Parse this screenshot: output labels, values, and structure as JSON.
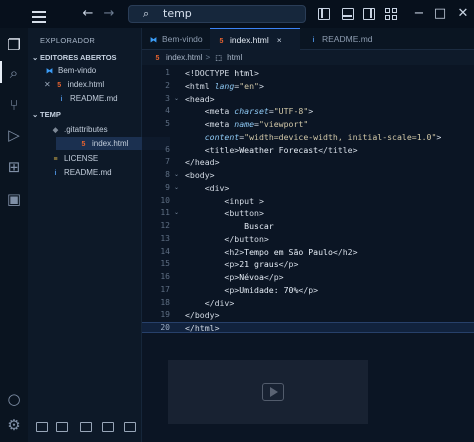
{
  "window": {
    "search_text": "temp",
    "search_icon": "⌕",
    "back_glyph": "←",
    "forward_glyph": "→",
    "minimize_glyph": "−",
    "maximize_glyph": "□",
    "close_glyph": "✕"
  },
  "sidebar": {
    "title": "EXPLORADOR",
    "open_editors_label": "EDITORES ABERTOS",
    "open_editors": [
      {
        "name": "Bem-vindo",
        "icon": "vscode-icon",
        "badge": "⚒"
      },
      {
        "name": "index.html",
        "icon": "html-icon",
        "badge": "5"
      },
      {
        "name": "README.md",
        "icon": "markdown-icon",
        "badge": "i"
      }
    ],
    "folder_label": "TEMP",
    "files": [
      {
        "name": ".gitattributes",
        "icon": "git-icon",
        "badge": "◆"
      },
      {
        "name": "index.html",
        "icon": "html-icon",
        "badge": "5"
      },
      {
        "name": "LICENSE",
        "icon": "license-icon",
        "badge": "≡"
      },
      {
        "name": "README.md",
        "icon": "markdown-icon",
        "badge": "i"
      }
    ]
  },
  "tabs": [
    {
      "label": "Bem-vindo",
      "badge": "⚒"
    },
    {
      "label": "index.html",
      "badge": "5",
      "close": "×"
    },
    {
      "label": "README.md",
      "badge": "i"
    }
  ],
  "breadcrumb": {
    "file": "index.html",
    "file_badge": "5",
    "node": "html",
    "node_badge": "⬚",
    "separator": ">"
  },
  "editor": {
    "line_numbers": [
      "1",
      "2",
      "3",
      "4",
      "5",
      "6",
      "7",
      "8",
      "9",
      "10",
      "11",
      "12",
      "13",
      "14",
      "15",
      "16",
      "17",
      "18",
      "19",
      "20"
    ],
    "current_line": 20,
    "lines": [
      [
        "<!DOCTYPE ",
        "html",
        ">"
      ],
      [
        "<html ",
        "lang",
        "=",
        "\"en\"",
        ">"
      ],
      [
        "<head>"
      ],
      [
        "    <meta ",
        "charset",
        "=",
        "\"UTF-8\"",
        ">"
      ],
      [
        "    <meta ",
        "name",
        "=",
        "\"viewport\""
      ],
      [
        "    ",
        "content",
        "=",
        "\"width=device-width, initial-scale=1.0\"",
        ">"
      ],
      [
        "    <title>",
        "Weather Forecast",
        "</title>"
      ],
      [
        "</head>"
      ],
      [
        "<body>"
      ],
      [
        "    <div>"
      ],
      [
        "        <input >"
      ],
      [
        "        <button>"
      ],
      [
        "            Buscar"
      ],
      [
        "        </button>"
      ],
      [
        "        <h2>",
        "Tempo em São Paulo",
        "</h2>"
      ],
      [
        "        <p>",
        "21 graus",
        "</p>"
      ],
      [
        "        <p>",
        "Névoa",
        "</p>"
      ],
      [
        "        <p>",
        "Umidade: 70%",
        "</p>"
      ],
      [
        "    </div>"
      ],
      [
        "</body>"
      ],
      [
        "</html>"
      ]
    ]
  },
  "colors": {
    "tag": "#d4dbe5",
    "attribute": "#8fcaf5",
    "string": "#d2c8a8",
    "accent": "#3b82f6",
    "html_icon": "#e8632f",
    "vscode_icon": "#3b9cf5"
  }
}
